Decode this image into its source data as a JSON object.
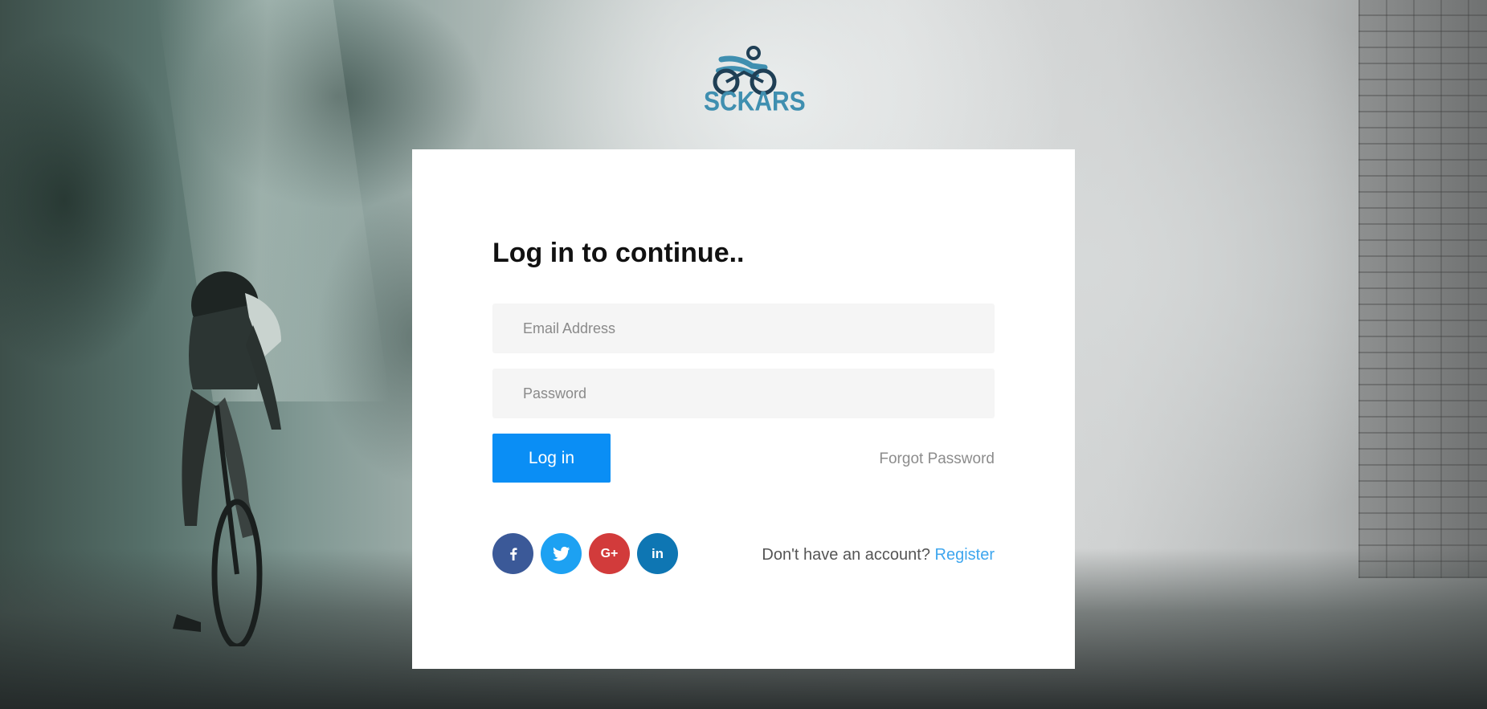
{
  "brand": {
    "name": "SCKARS",
    "colors": {
      "primary": "#3f8fb0",
      "dark": "#1f3f55"
    }
  },
  "login": {
    "title": "Log in to continue..",
    "email_placeholder": "Email Address",
    "password_placeholder": "Password",
    "login_button": "Log in",
    "forgot_password": "Forgot Password",
    "no_account_text": "Don't have an account?",
    "register_link": "Register"
  },
  "social": [
    {
      "name": "facebook",
      "icon": "facebook-icon",
      "glyph": "f",
      "color": "#3b5998"
    },
    {
      "name": "twitter",
      "icon": "twitter-icon",
      "glyph": "bird",
      "color": "#1da1f2"
    },
    {
      "name": "google-plus",
      "icon": "google-plus-icon",
      "glyph": "G+",
      "color": "#d23b3b"
    },
    {
      "name": "linkedin",
      "icon": "linkedin-icon",
      "glyph": "in",
      "color": "#0e76b3"
    }
  ],
  "colors": {
    "accent": "#0a8ef5",
    "link": "#3ea6ee",
    "card": "#ffffff",
    "field": "#f5f5f5"
  }
}
